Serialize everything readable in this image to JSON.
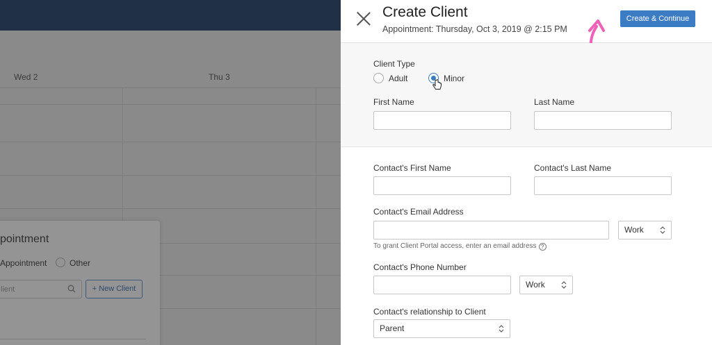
{
  "background": {
    "day_headers": [
      "Wed 2",
      "Thu 3"
    ],
    "popup": {
      "title_fragment": "pointment",
      "option_appointment": "Appointment",
      "option_other": "Other",
      "search_placeholder_fragment": "lient",
      "new_client_button": "+ New Client"
    }
  },
  "drawer": {
    "title": "Create Client",
    "subtitle": "Appointment: Thursday, Oct 3, 2019 @ 2:15 PM",
    "primary_button": "Create & Continue",
    "client_type": {
      "label": "Client Type",
      "options": [
        "Adult",
        "Minor"
      ],
      "selected": "Minor"
    },
    "first_name": {
      "label": "First Name",
      "value": ""
    },
    "last_name": {
      "label": "Last Name",
      "value": ""
    },
    "contact_first_name": {
      "label": "Contact's First Name",
      "value": ""
    },
    "contact_last_name": {
      "label": "Contact's Last Name",
      "value": ""
    },
    "contact_email": {
      "label": "Contact's Email Address",
      "value": "",
      "type_select": "Work",
      "help": "To grant Client Portal access, enter an email address"
    },
    "contact_phone": {
      "label": "Contact's Phone Number",
      "value": "",
      "type_select": "Work"
    },
    "relationship": {
      "label": "Contact's relationship to Client",
      "select": "Parent"
    }
  },
  "colors": {
    "accent": "#3c7cc4",
    "annotation": "#f060b8",
    "topbar": "#1f3047"
  }
}
